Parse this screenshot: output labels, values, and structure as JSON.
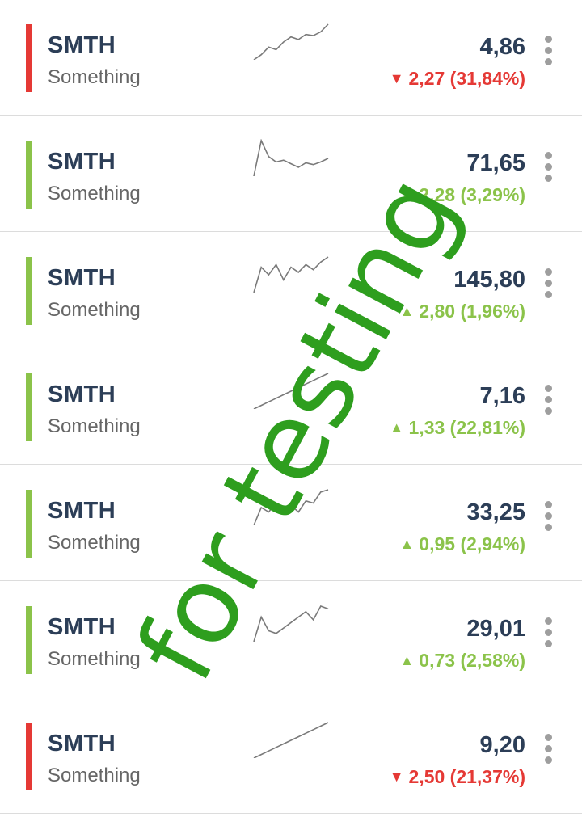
{
  "colors": {
    "up": "#8bc34a",
    "down": "#e53935",
    "text": "#2c3e57",
    "muted": "#666666",
    "spark": "#7a7a7a",
    "watermark": "#2e9e1e"
  },
  "watermark": {
    "text": "for testing"
  },
  "rows": [
    {
      "symbol": "SMTH",
      "name": "Something",
      "price": "4,86",
      "change": "2,27 (31,84%)",
      "direction": "down",
      "arrow": "▼",
      "spark": [
        30,
        34,
        40,
        38,
        44,
        48,
        46,
        50,
        49,
        52,
        58
      ]
    },
    {
      "symbol": "SMTH",
      "name": "Something",
      "price": "71,65",
      "change": "2,28 (3,29%)",
      "direction": "up",
      "arrow": "▲",
      "spark": [
        20,
        60,
        42,
        36,
        38,
        34,
        30,
        35,
        33,
        36,
        40
      ]
    },
    {
      "symbol": "SMTH",
      "name": "Something",
      "price": "145,80",
      "change": "2,80 (1,96%)",
      "direction": "up",
      "arrow": "▲",
      "spark": [
        30,
        50,
        44,
        52,
        40,
        50,
        46,
        52,
        48,
        54,
        58
      ]
    },
    {
      "symbol": "SMTH",
      "name": "Something",
      "price": "7,16",
      "change": "1,33 (22,81%)",
      "direction": "up",
      "arrow": "▲",
      "spark": [
        30,
        32,
        34,
        36,
        38,
        40,
        42,
        44,
        46,
        48,
        50
      ]
    },
    {
      "symbol": "SMTH",
      "name": "Something",
      "price": "33,25",
      "change": "0,95 (2,94%)",
      "direction": "up",
      "arrow": "▲",
      "spark": [
        28,
        44,
        40,
        48,
        42,
        46,
        40,
        50,
        48,
        58,
        60
      ]
    },
    {
      "symbol": "SMTH",
      "name": "Something",
      "price": "29,01",
      "change": "0,73 (2,58%)",
      "direction": "up",
      "arrow": "▲",
      "spark": [
        30,
        48,
        38,
        36,
        40,
        44,
        48,
        52,
        46,
        56,
        54
      ]
    },
    {
      "symbol": "SMTH",
      "name": "Something",
      "price": "9,20",
      "change": "2,50 (21,37%)",
      "direction": "down",
      "arrow": "▼",
      "spark": [
        30,
        33,
        36,
        39,
        42,
        45,
        48,
        51,
        54,
        57,
        60
      ]
    }
  ]
}
